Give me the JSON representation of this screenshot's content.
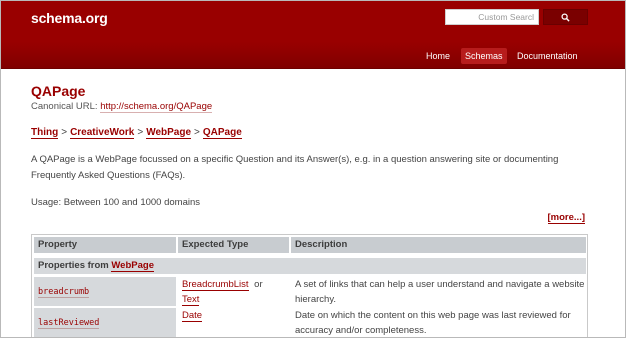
{
  "header": {
    "logo": "schema.org",
    "search_placeholder": "Custom Searcl",
    "search_button_icon": "magnifier-icon"
  },
  "nav": {
    "items": [
      {
        "label": "Home"
      },
      {
        "label": "Schemas",
        "active": true
      },
      {
        "label": "Documentation"
      }
    ]
  },
  "page": {
    "title": "QAPage",
    "canonical_label": "Canonical URL:",
    "canonical_url": "http://schema.org/QAPage",
    "breadcrumb": [
      "Thing",
      "CreativeWork",
      "WebPage",
      "QAPage"
    ],
    "breadcrumb_sep": ">",
    "description": "A QAPage is a WebPage focussed on a specific Question and its Answer(s), e.g. in a question answering site or documenting Frequently Asked Questions (FAQs).",
    "usage": "Usage: Between 100 and 1000 domains",
    "more_link": "[more...]"
  },
  "table": {
    "headers": [
      "Property",
      "Expected Type",
      "Description"
    ],
    "section_prefix": "Properties from",
    "section_link": "WebPage",
    "rows": [
      {
        "property": "breadcrumb",
        "types": [
          "BreadcrumbList",
          "Text"
        ],
        "types_joiner": "or",
        "description": "A set of links that can help a user understand and navigate a website hierarchy."
      },
      {
        "property": "lastReviewed",
        "types": [
          "Date"
        ],
        "description": "Date on which the content on this web page was last reviewed for accuracy and/or completeness."
      }
    ]
  },
  "colors": {
    "brand": "#990000",
    "table_header": "#c8ccd0",
    "table_cell": "#d6d9dc"
  }
}
